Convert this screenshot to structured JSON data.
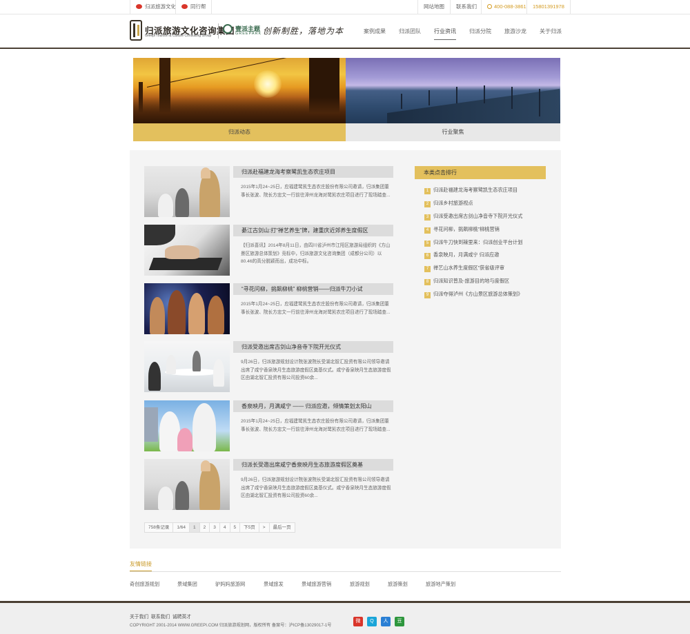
{
  "topbar": {
    "weibo_label": "归派旅游文化",
    "tong_label": "同行帮",
    "sitemap": "网站地图",
    "contact": "联系我们",
    "phone": "400-088-3861",
    "mobile": "15801391978"
  },
  "header": {
    "logo_title": "归派旅游文化咨询集团",
    "logo_sub": "Greepi Tourism & Culture Consulting Group",
    "partner_title": "壹派主题",
    "partner_sub": "GREEPARK",
    "slogan": "创新制胜，落地为本",
    "nav": [
      "案例成果",
      "归派团队",
      "行业资讯",
      "归派分院",
      "旅游沙龙",
      "关于归派"
    ],
    "active_nav": "行业资讯"
  },
  "banner": {
    "tab1": "归派动态",
    "tab2": "行业聚焦"
  },
  "articles": [
    {
      "title": "归派赴福建龙海考察鹭凯生态农庄项目",
      "body": "2015年1月24~25日，应福建鹭凯生态农庄股份有限公司邀请，归派集团董事长张波、院长方忠文一行前往漳州龙海对鹭凯农庄项目进行了现场踏查..."
    },
    {
      "title": "綦江古剑山:打“禅艺养生”牌，建重庆近郊养生度假区",
      "body": "【归派喜讯】2014年8月11日，由四川省泸州市江阳区旅游局组织的《方山景区旅游总体策划》竞标中，归派旅游文化咨询集团（成都分公司）以80.46的高分脱颖而出，成功中标。"
    },
    {
      "title": "“寻花问柳，挑飙柳桃”  柳桃营销——归派牛刀小试",
      "body": "2015年1月24~25日，应福建鹭凯生态农庄股份有限公司邀请，归派集团董事长张波、院长方忠文一行前往漳州龙海对鹭凯农庄项目进行了现场踏查..."
    },
    {
      "title": "归派受邀出席古剑山净音寺下院开光仪式",
      "body": "9月26日，归派旅游规划设计院张波院长受湖北智汇投资有限公司领导邀请出席了咸宁香泉映月生态旅游度假区奠基仪式。咸宁香泉映月生态旅游度假区由湖北智汇投资有限公司投资60余..."
    },
    {
      "title": "香泉映月，月满咸宁 —— 归派应邀，倾情策划太阳山",
      "body": "2015年1月24~25日，应福建鹭凯生态农庄股份有限公司邀请，归派集团董事长张波、院长方忠文一行前往漳州龙海对鹭凯农庄项目进行了现场踏查..."
    },
    {
      "title": "归派长受邀出席咸宁香泉映月生态旅游度假区奠基",
      "body": "9月26日，归派旅游规划设计院张波院长受湖北智汇投资有限公司领导邀请出席了咸宁香泉映月生态旅游度假区奠基仪式。咸宁香泉映月生态旅游度假区由湖北智汇投资有限公司投资60余..."
    }
  ],
  "pager": {
    "total": "758条记录",
    "pages": "1/64",
    "p1": "1",
    "p2": "2",
    "p3": "3",
    "p4": "4",
    "p5": "5",
    "next5": "下5页",
    "next": ">",
    "last": "最后一页"
  },
  "sidebar": {
    "title": "本类点击排行",
    "items": [
      {
        "num": "1",
        "label": "归派赴福建龙海考察鹭凯生态农庄项目"
      },
      {
        "num": "2",
        "label": "归派乡村旅游视点"
      },
      {
        "num": "3",
        "label": "归派受邀出席古剑山净音寺下院开光仪式"
      },
      {
        "num": "4",
        "label": "寻花问柳，挑飙柳桃”柳桃营销"
      },
      {
        "num": "5",
        "label": "归派牛刀快到辣里来：归派创业平台计划"
      },
      {
        "num": "6",
        "label": "香泉映月，月满咸宁 归派应邀"
      },
      {
        "num": "7",
        "label": "禅艺山水养生度假区”获省级评审"
      },
      {
        "num": "8",
        "label": "归派知识普及-旅游目的地与度假区"
      },
      {
        "num": "9",
        "label": "归派夺得泸州《方山景区旅游总体策划》"
      }
    ]
  },
  "links": {
    "title": "友情链接",
    "items": [
      "奇创旅游规划",
      "景域集团",
      "驴妈妈旅游网",
      "景域旅发",
      "景域旅游营销",
      "旅游规划",
      "旅游策划",
      "旅游地产策划"
    ]
  },
  "footer": {
    "about": "关于我们",
    "contact": "联系我们",
    "jobs": "诚聘英才",
    "copyright": "COPYRIGHT 2001-2014 WWW.GREEPI.COM 归派旅游规划网，版权所有    备案号：沪ICP备13029017-1号",
    "share_weibo": "微",
    "share_qq": "Q",
    "share_renren": "人",
    "share_douban": "豆"
  },
  "colors": {
    "accent": "#e3c05d",
    "dark": "#4a3f33",
    "phone": "#d39a1f"
  }
}
